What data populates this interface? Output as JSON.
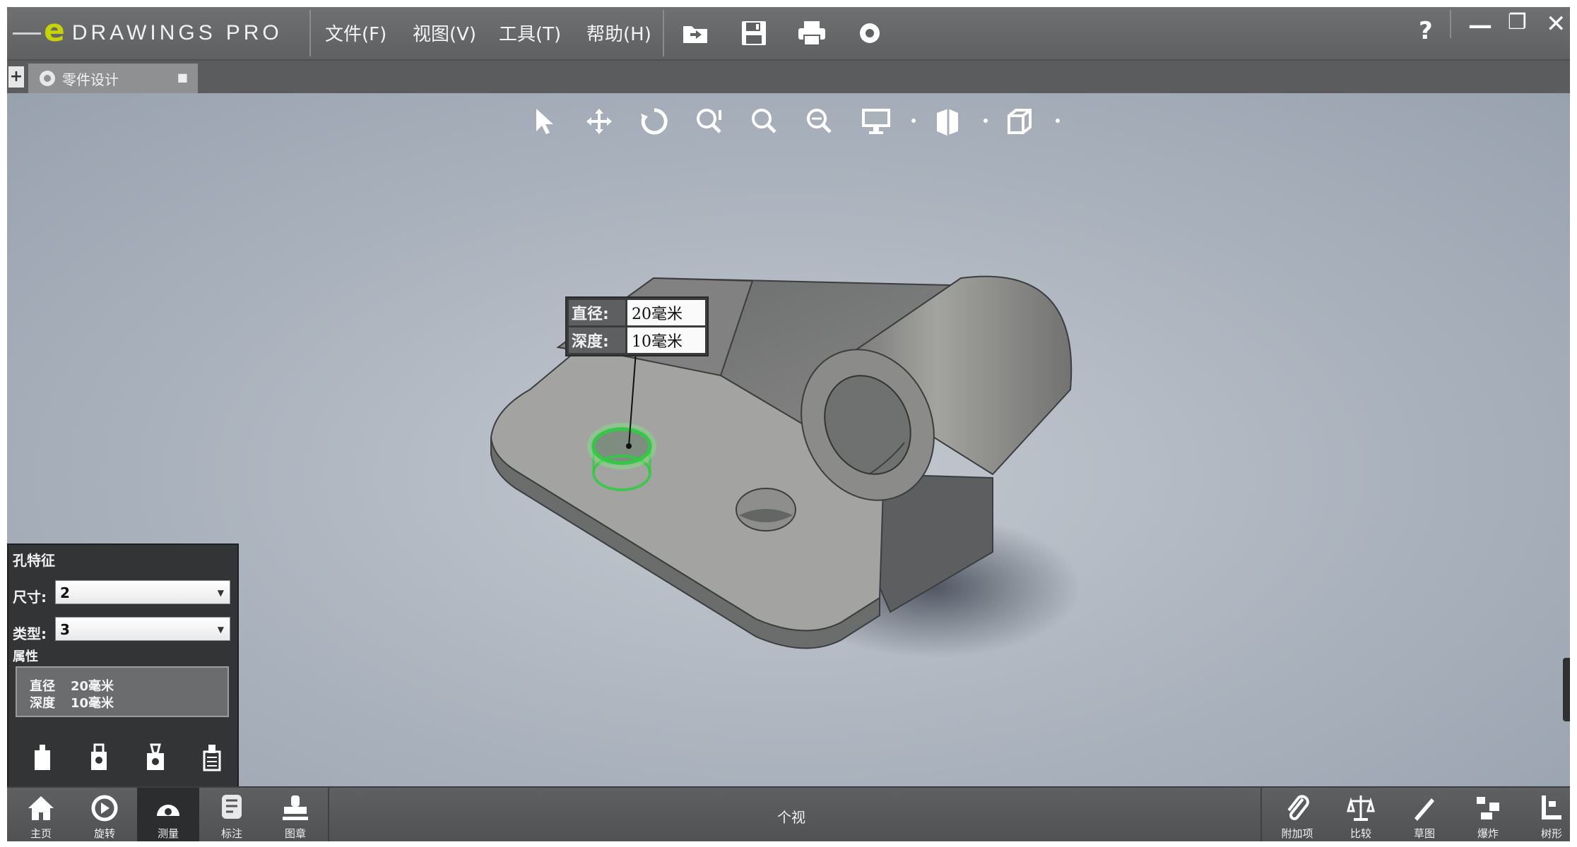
{
  "app": {
    "logo_letter": "e",
    "logo_text": "DRAWINGS",
    "logo_suffix": "PRO",
    "brand_color": "#c8d400"
  },
  "menu": {
    "file": "文件(F)",
    "view": "视图(V)",
    "tools": "工具(T)",
    "help": "帮助(H)"
  },
  "toolbar_icons": [
    "open-icon",
    "save-icon",
    "print-icon",
    "settings-icon"
  ],
  "window_controls": {
    "help": "?",
    "minimize": "—",
    "restore": "❐",
    "close": "✕"
  },
  "tabs": {
    "plus": "+",
    "document_name": "零件设计",
    "close": "■"
  },
  "view_toolbar": [
    "select-icon",
    "pan-icon",
    "rotate-icon",
    "zoom-to-fit-icon",
    "zoom-icon",
    "zoom-area-icon",
    "display-icon",
    "section-icon",
    "view-orientation-icon"
  ],
  "callout": {
    "rows": [
      {
        "label": "直径:",
        "value": "20毫米"
      },
      {
        "label": "深度:",
        "value": "10毫米"
      }
    ],
    "highlight_color": "#2ecc40"
  },
  "panel": {
    "title": "孔特征",
    "size_label": "尺寸:",
    "size_value": "2",
    "type_label": "类型:",
    "type_value": "3",
    "props_title": "属性",
    "props": [
      {
        "label": "直径",
        "value": "20毫米"
      },
      {
        "label": "深度",
        "value": "10毫米"
      }
    ]
  },
  "bottombar": {
    "left_buttons": [
      {
        "name": "home",
        "label": "主页"
      },
      {
        "name": "rotate",
        "label": "旋转"
      },
      {
        "name": "measure",
        "label": "测量"
      },
      {
        "name": "markup",
        "label": "标注"
      },
      {
        "name": "stamp",
        "label": "图章"
      }
    ],
    "center_text": "个视",
    "right_buttons": [
      {
        "name": "attach",
        "label": "附加项"
      },
      {
        "name": "compare",
        "label": "比较"
      },
      {
        "name": "sketch",
        "label": "草图"
      },
      {
        "name": "explode",
        "label": "爆炸"
      },
      {
        "name": "tree",
        "label": "树形"
      }
    ]
  }
}
